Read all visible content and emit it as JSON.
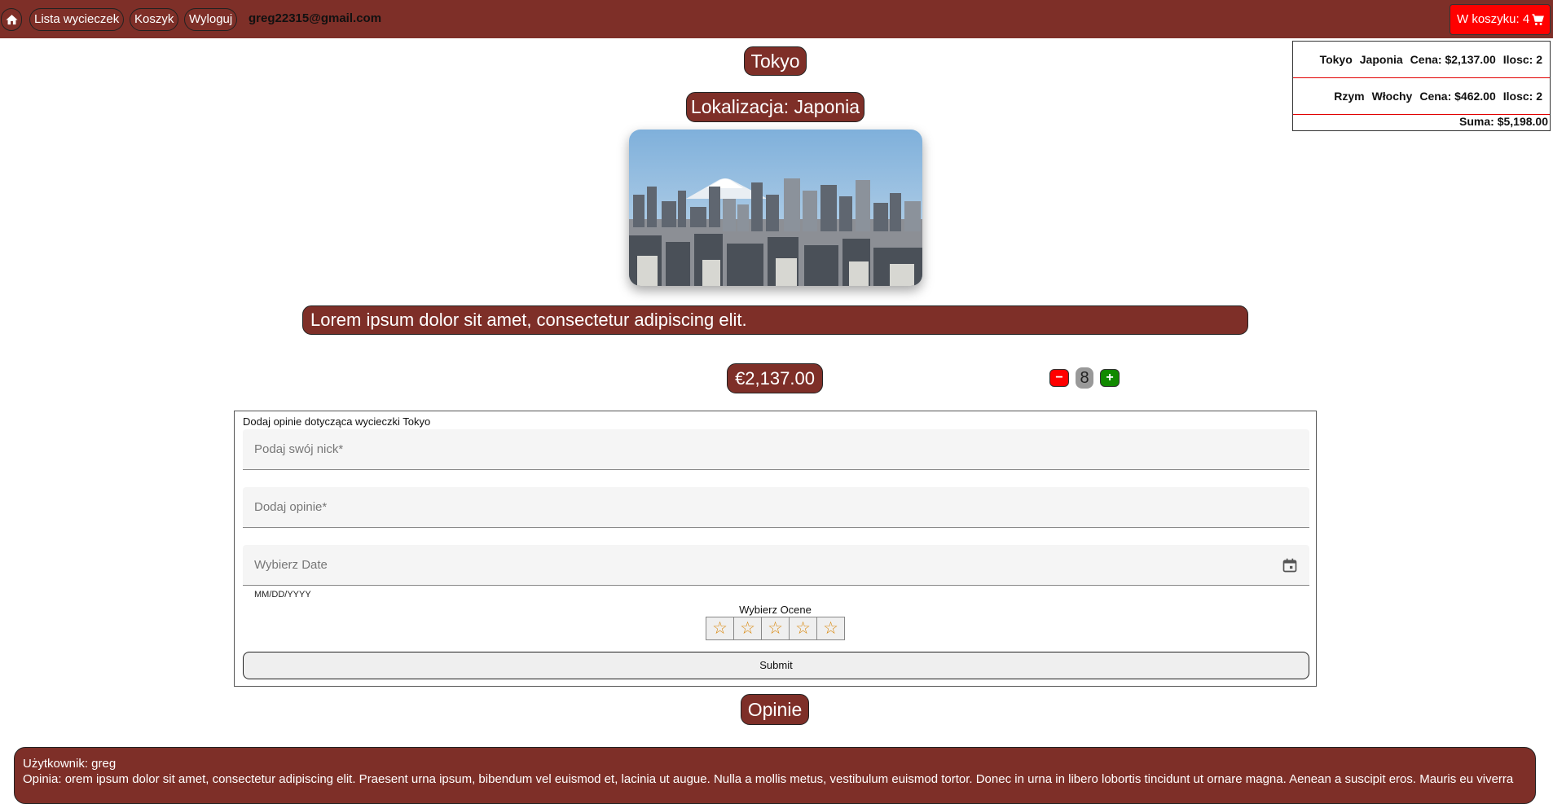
{
  "nav": {
    "home_icon": "home-icon",
    "items": [
      "Lista wycieczek",
      "Koszyk",
      "Wyloguj"
    ],
    "user_email": "greg22315@gmail.com",
    "cart_label": "W koszyku: 4",
    "cart_icon": "cart-icon"
  },
  "cart": {
    "items": [
      {
        "name": "Tokyo",
        "country": "Japonia",
        "price": "Cena: $2,137.00",
        "qty": "Ilosc: 2"
      },
      {
        "name": "Rzym",
        "country": "Włochy",
        "price": "Cena: $462.00",
        "qty": "Ilosc: 2"
      }
    ],
    "sum": "Suma: $5,198.00"
  },
  "trip": {
    "title": "Tokyo",
    "location": "Lokalizacja: Japonia",
    "description": "Lorem ipsum dolor sit amet, consectetur adipiscing elit.",
    "price": "€2,137.00",
    "quantity": "8",
    "minus": "−",
    "plus": "+"
  },
  "form": {
    "heading": "Dodaj opinie dotycząca wycieczki Tokyo",
    "nick_placeholder": "Podaj swój nick*",
    "opinion_placeholder": "Dodaj opinie*",
    "date_placeholder": "Wybierz Date",
    "date_hint": "MM/DD/YYYY",
    "rating_label": "Wybierz Ocene",
    "star": "☆",
    "submit": "Submit"
  },
  "opinions": {
    "title": "Opinie",
    "user": "Użytkownik: greg",
    "text": "Opinia: orem ipsum dolor sit amet, consectetur adipiscing elit. Praesent urna ipsum, bibendum vel euismod et, lacinia ut augue. Nulla a mollis metus, vestibulum euismod tortor. Donec in urna in libero lobortis tincidunt ut ornare magna. Aenean a suscipit eros. Mauris eu viverra"
  },
  "colors": {
    "brand": "#7e2f28",
    "cart_button": "#ff0000",
    "minus": "#ff0000",
    "plus": "#118a00",
    "star": "#d9890f"
  }
}
